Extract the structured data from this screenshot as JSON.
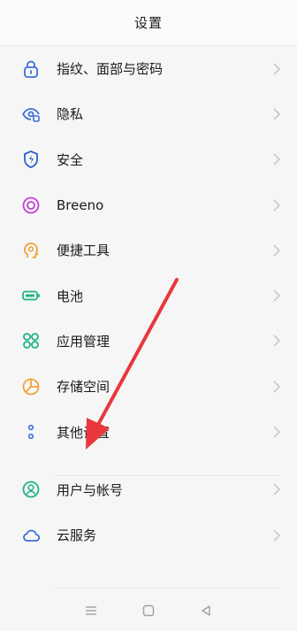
{
  "header": {
    "title": "设置"
  },
  "menu": {
    "items": [
      {
        "label": "指纹、面部与密码",
        "icon": "lock-icon",
        "color": "#3b6fd8"
      },
      {
        "label": "隐私",
        "icon": "privacy-eye-icon",
        "color": "#3b6fd8"
      },
      {
        "label": "安全",
        "icon": "shield-icon",
        "color": "#2f5fd0"
      },
      {
        "label": "Breeno",
        "icon": "breeno-icon",
        "color": "#c13fd6"
      },
      {
        "label": "便捷工具",
        "icon": "head-tool-icon",
        "color": "#f0a33a"
      },
      {
        "label": "电池",
        "icon": "battery-icon",
        "color": "#1fb28a"
      },
      {
        "label": "应用管理",
        "icon": "apps-grid-icon",
        "color": "#1fb28a"
      },
      {
        "label": "存储空间",
        "icon": "storage-pie-icon",
        "color": "#f0a33a"
      },
      {
        "label": "其他设置",
        "icon": "more-dots-icon",
        "color": "#3b6fd8"
      },
      {
        "label": "用户与帐号",
        "icon": "user-icon",
        "color": "#1fb28a"
      },
      {
        "label": "云服务",
        "icon": "cloud-icon",
        "color": "#3b6fd8"
      }
    ]
  },
  "navbar": {
    "buttons": [
      "menu-icon",
      "home-icon",
      "back-icon"
    ]
  },
  "annotation": {
    "arrow_color": "#e8383d"
  }
}
